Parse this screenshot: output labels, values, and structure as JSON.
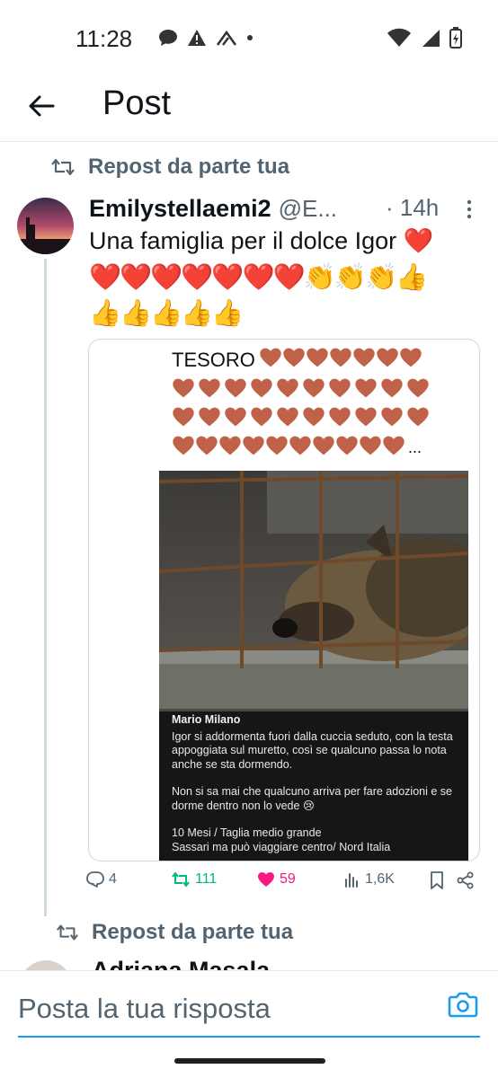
{
  "status_bar": {
    "time": "11:28"
  },
  "header": {
    "title": "Post"
  },
  "repost_label": "Repost da parte tua",
  "tweet": {
    "name": "Emilystellaemi2",
    "handle": "@E...",
    "time": "· 14h",
    "text": "Una famiglia per il dolce Igor ❤️",
    "emoji_line_1": "❤️❤️❤️❤️❤️❤️❤️👏👏👏👍",
    "emoji_line_2": "👍👍👍👍👍"
  },
  "media": {
    "tesoro": "TESORO",
    "ellipsis": "...",
    "caption_name": "Mario Milano",
    "caption_p1": "Igor si addormenta fuori dalla cuccia seduto, con la testa appoggiata sul muretto, così se qualcuno passa lo nota anche se sta dormendo.",
    "caption_p2": "Non si sa mai che qualcuno arriva per fare adozioni e se dorme dentro non lo vede 😢",
    "caption_p3a": "10 Mesi / Taglia medio grande",
    "caption_p3b": "Sassari ma può viaggiare centro/ Nord Italia"
  },
  "actions": {
    "replies": "4",
    "reposts": "111",
    "likes": "59",
    "views": "1,6K"
  },
  "tweet2": {
    "repost_label": "Repost da parte tua",
    "name": "Adriana Masala"
  },
  "reply": {
    "placeholder": "Posta la tua risposta"
  },
  "colors": {
    "accent": "#1d9bf0",
    "repost_green": "#00ba7c",
    "like_pink": "#f91880",
    "secondary_text": "#536471"
  }
}
